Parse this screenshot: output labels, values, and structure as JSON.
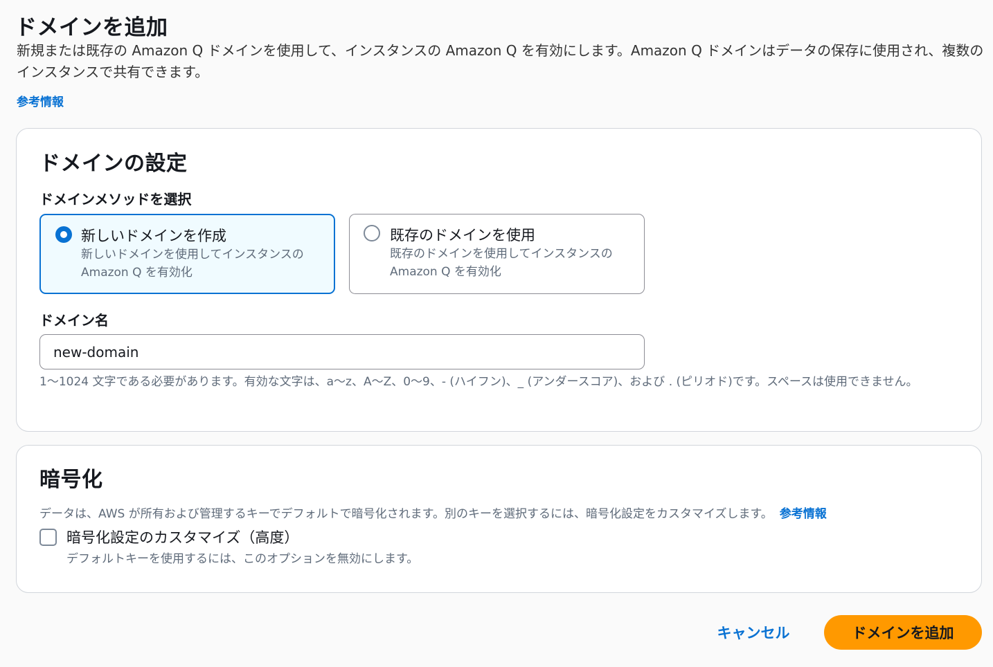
{
  "header": {
    "title": "ドメインを追加",
    "description": "新規または既存の Amazon Q ドメインを使用して、インスタンスの Amazon Q を有効にします。Amazon Q ドメインはデータの保存に使用され、複数のインスタンスで共有できます。",
    "info_link": "参考情報"
  },
  "domain_settings": {
    "title": "ドメインの設定",
    "method_label": "ドメインメソッドを選択",
    "options": [
      {
        "label": "新しいドメインを作成",
        "description": "新しいドメインを使用してインスタンスの Amazon Q を有効化",
        "selected": true
      },
      {
        "label": "既存のドメインを使用",
        "description": "既存のドメインを使用してインスタンスの Amazon Q を有効化",
        "selected": false
      }
    ],
    "name_label": "ドメイン名",
    "name_value": "new-domain",
    "constraint": "1〜1024 文字である必要があります。有効な文字は、a〜z、A〜Z、0〜9、- (ハイフン)、_ (アンダースコア)、および . (ピリオド)です。スペースは使用できません。"
  },
  "encryption": {
    "title": "暗号化",
    "description": "データは、AWS が所有および管理するキーでデフォルトで暗号化されます。別のキーを選択するには、暗号化設定をカスタマイズします。",
    "info_link": "参考情報",
    "checkbox_label": "暗号化設定のカスタマイズ（高度）",
    "checkbox_description": "デフォルトキーを使用するには、このオプションを無効にします。",
    "checked": false
  },
  "actions": {
    "cancel": "キャンセル",
    "submit": "ドメインを追加"
  },
  "colors": {
    "link": "#0972d3",
    "primary_button": "#ff9900",
    "selected_border": "#0972d3",
    "selected_background": "#f0fbff"
  }
}
